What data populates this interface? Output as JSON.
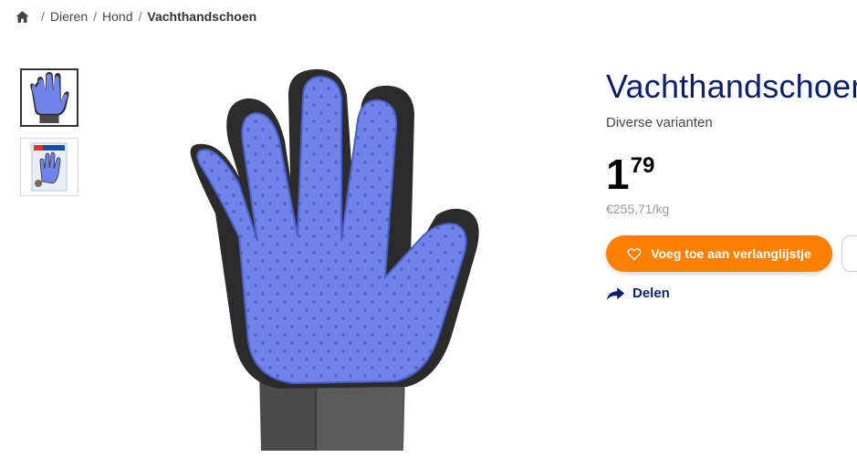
{
  "breadcrumb": {
    "home_icon": "home-icon",
    "items": [
      "Dieren",
      "Hond"
    ],
    "current": "Vachthandschoen",
    "separator": "/"
  },
  "gallery": {
    "thumbnails": [
      {
        "icon": "glove-thumbnail",
        "selected": true
      },
      {
        "icon": "glove-package-thumbnail",
        "selected": false
      }
    ],
    "main_image_icon": "grooming-glove-image"
  },
  "product": {
    "title": "Vachthandschoen",
    "subtitle": "Diverse varianten",
    "price_euros": "1",
    "price_cents": "79",
    "unit_price": "€255,71/kg"
  },
  "actions": {
    "wishlist_label": "Voeg toe aan verlanglijstje",
    "wishlist_icon": "heart-outline-icon",
    "share_label": "Delen",
    "share_icon": "share-arrow-icon"
  },
  "colors": {
    "brand_navy": "#0a1f6e",
    "accent_orange": "#ff7f00",
    "glove_blue": "#6f83e8",
    "glove_black": "#2b2b2b"
  }
}
